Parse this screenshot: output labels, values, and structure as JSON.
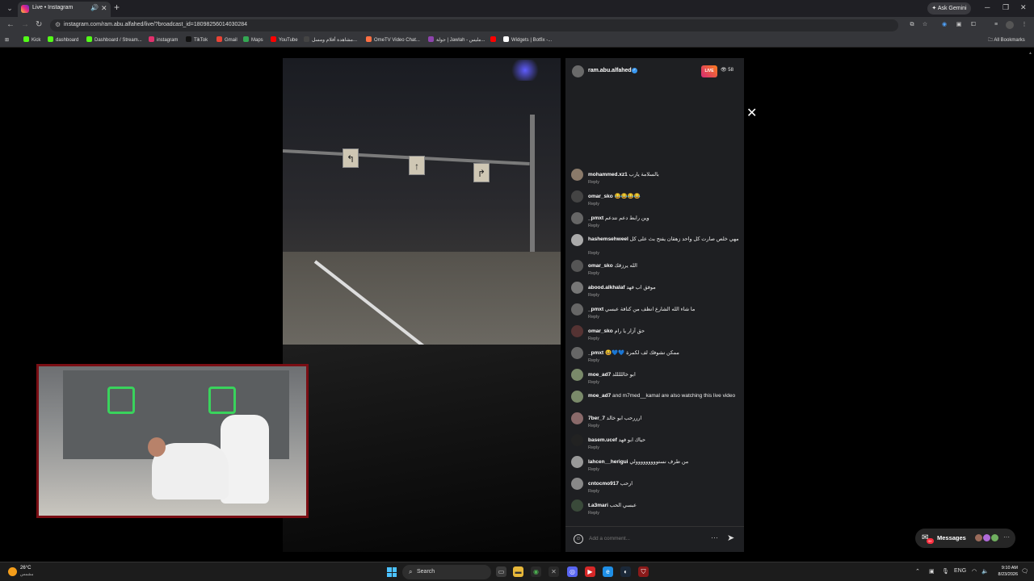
{
  "browser": {
    "tab_title": "Live • Instagram",
    "new_tab_symbol": "+",
    "ask_gemini": "Ask Gemini",
    "url": "instagram.com/ram.abu.alfahed/live/?broadcast_id=18098256014030284",
    "bookmarks": [
      {
        "label": "Kick",
        "color": "#53fc18"
      },
      {
        "label": "dashboard",
        "color": "#53fc18"
      },
      {
        "label": "Dashboard / Stream...",
        "color": "#53fc18"
      },
      {
        "label": "instagram",
        "color": "#e1306c"
      },
      {
        "label": "TikTok",
        "color": "#111111"
      },
      {
        "label": "Gmail",
        "color": "#ea4335"
      },
      {
        "label": "Maps",
        "color": "#34a853"
      },
      {
        "label": "YouTube",
        "color": "#ff0000"
      },
      {
        "label": "مشاهدة أفلام ومسل...",
        "color": "#444444"
      },
      {
        "label": "OmeTV Video Chat...",
        "color": "#ff7043"
      },
      {
        "label": "جولة | Jawlah - مليس...",
        "color": "#8e44ad"
      },
      {
        "label": "",
        "color": "#ff0000"
      },
      {
        "label": "Widgets | Botfix -...",
        "color": "#ffffff"
      }
    ],
    "all_bookmarks": "All Bookmarks"
  },
  "live": {
    "username": "ram.abu.alfahed",
    "live_badge": "LIVE",
    "viewer_count": "58",
    "close_symbol": "✕"
  },
  "comments": [
    {
      "user": "mohammed.xz1",
      "text": "بالسلامة يارب",
      "reply": "Reply"
    },
    {
      "user": "omar_sko",
      "text": "😂😂😂😂",
      "reply": "Reply"
    },
    {
      "user": "_pmxt",
      "text": "وين رابط دعم نتدعم",
      "reply": "Reply"
    },
    {
      "user": "hashemsehweel",
      "text": "مهي خلص صارت كل واحد زهقان يفتح بث على كل",
      "reply": "Reply"
    },
    {
      "user": "omar_sko",
      "text": "الله يرزقك",
      "reply": "Reply"
    },
    {
      "user": "abood.alkhalaf",
      "text": "موفق اب فهد",
      "reply": "Reply"
    },
    {
      "user": "_pmxt",
      "text": "ما شاء الله الشارع انظف من كنافة عبسي",
      "reply": "Reply"
    },
    {
      "user": "omar_sko",
      "text": "حق آزار يا رام",
      "reply": "Reply"
    },
    {
      "user": "_pmxt",
      "text": "😆💙💙 ممكن نشوفك لف لكمرة",
      "reply": "Reply"
    },
    {
      "user": "moe_ad7",
      "text": "ابو خالللللد",
      "reply": "Reply"
    },
    {
      "user": "moe_ad7",
      "text": "and m7med__kamal are also watching this live video",
      "reply": ""
    },
    {
      "user": "7ber_7",
      "text": "ارررحب ابو خالد",
      "reply": "Reply"
    },
    {
      "user": "basem.ucef",
      "text": "حياك ابو فهد",
      "reply": "Reply"
    },
    {
      "user": "lahcen__herigui",
      "text": "من طرف نستووووووووولي",
      "reply": "Reply"
    },
    {
      "user": "cntocmo917",
      "text": "ارحب",
      "reply": "Reply"
    },
    {
      "user": "t.a3mari",
      "text": "عبسي الحب",
      "reply": "Reply"
    }
  ],
  "input": {
    "placeholder": "Add a comment...",
    "more": "···",
    "send": "➤"
  },
  "messages": {
    "label": "Messages",
    "badge": "9+"
  },
  "video_signs": [
    "↰",
    "↑",
    "↱"
  ],
  "taskbar": {
    "temperature": "26°C",
    "condition": "مشمس",
    "search": "Search",
    "lang": "ENG",
    "time": "9:10 AM",
    "date": "8/23/2026"
  }
}
